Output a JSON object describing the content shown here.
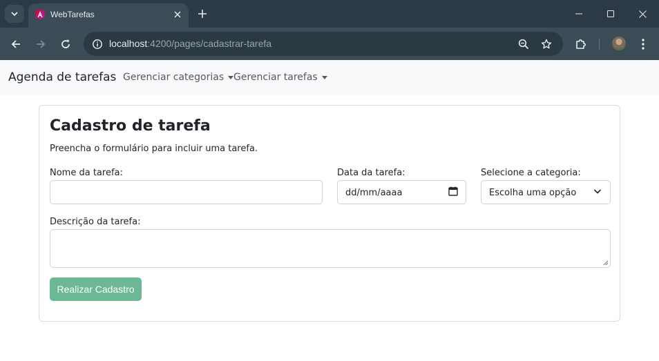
{
  "browser": {
    "tab_title": "WebTarefas",
    "url_host": "localhost",
    "url_path": ":4200/pages/cadastrar-tarefa"
  },
  "navbar": {
    "brand": "Agenda de tarefas",
    "links": [
      "Gerenciar categorias",
      "Gerenciar tarefas"
    ]
  },
  "form": {
    "title": "Cadastro de tarefa",
    "subtitle": "Preencha o formulário para incluir uma tarefa.",
    "nome_label": "Nome da tarefa:",
    "nome_value": "",
    "data_label": "Data da tarefa:",
    "data_placeholder": "dd/mm/aaaa",
    "categoria_label": "Selecione a categoria:",
    "categoria_selected": "Escolha uma opção",
    "descricao_label": "Descrição da tarefa:",
    "descricao_value": "",
    "submit_label": "Realizar Cadastro"
  },
  "colors": {
    "primary_button": "#6cb894",
    "tab_bar": "#2b3a44",
    "toolbar": "#3c4c57"
  }
}
